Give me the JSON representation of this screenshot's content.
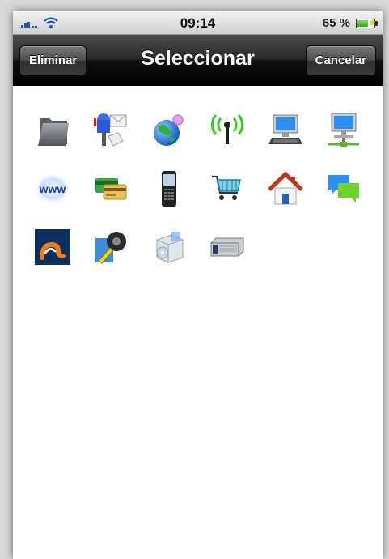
{
  "statusbar": {
    "time": "09:14",
    "battery_percent": "65 %",
    "battery_level": 0.65,
    "signal_icon": "signal-bars-icon",
    "wifi_icon": "wifi-icon"
  },
  "navbar": {
    "title": "Seleccionar",
    "left_button": "Eliminar",
    "right_button": "Cancelar"
  },
  "icons": [
    {
      "name": "folder-icon"
    },
    {
      "name": "mailbox-icon"
    },
    {
      "name": "globe-icon"
    },
    {
      "name": "antenna-icon"
    },
    {
      "name": "computer-icon"
    },
    {
      "name": "network-computer-icon"
    },
    {
      "name": "www-icon",
      "text": "www"
    },
    {
      "name": "credit-cards-icon"
    },
    {
      "name": "mobile-phone-icon"
    },
    {
      "name": "shopping-cart-icon"
    },
    {
      "name": "home-icon"
    },
    {
      "name": "chat-bubbles-icon"
    },
    {
      "name": "app-logo-icon"
    },
    {
      "name": "tape-measure-icon"
    },
    {
      "name": "installer-box-icon"
    },
    {
      "name": "router-device-icon"
    }
  ],
  "colors": {
    "navbar": "#000000",
    "accent_blue": "#1a57b8",
    "battery_green": "#2fa81b"
  }
}
